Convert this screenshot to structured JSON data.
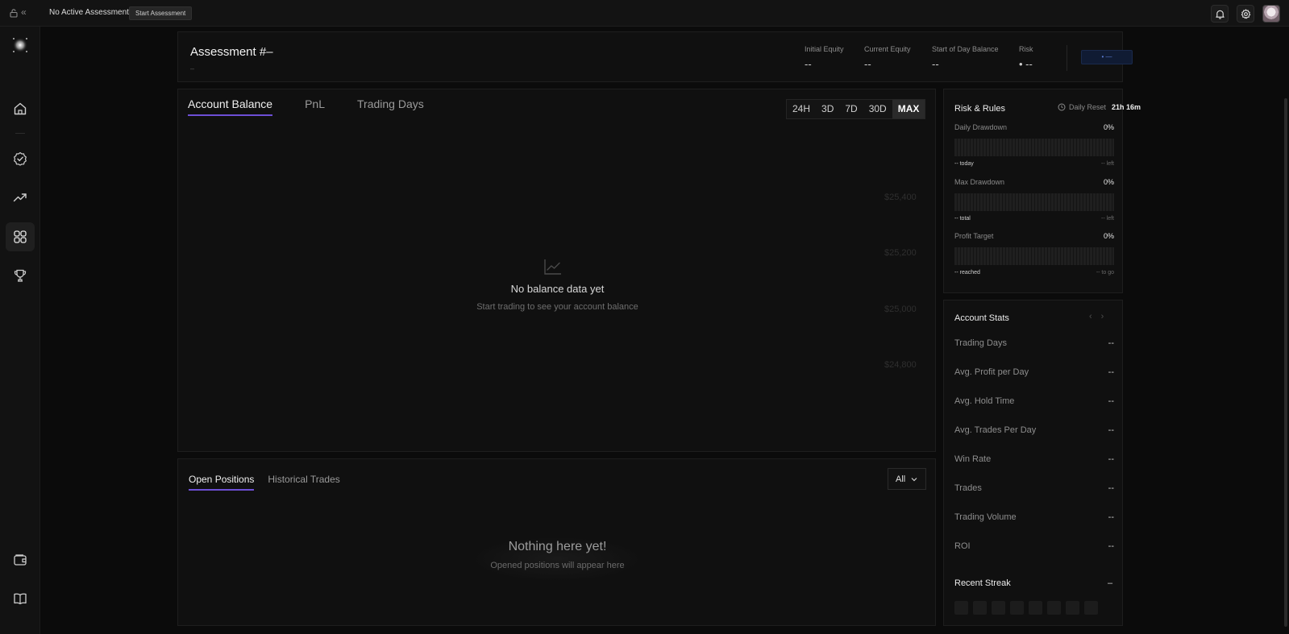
{
  "topbar": {
    "status_text": "No Active Assessment",
    "start_button": "Start Assessment",
    "collapse_glyph": "«",
    "icons": [
      "lock-icon",
      "bell-icon",
      "gear-icon"
    ]
  },
  "sidebar": {
    "items": [
      {
        "id": "home",
        "icon": "home-icon",
        "active": false
      },
      {
        "id": "assessments",
        "icon": "check-badge-icon",
        "active": false
      },
      {
        "id": "trading",
        "icon": "trend-up-icon",
        "active": false
      },
      {
        "id": "dashboard",
        "icon": "grid-icon",
        "active": true
      },
      {
        "id": "leaderboard",
        "icon": "trophy-icon",
        "active": false
      }
    ],
    "bottom_items": [
      {
        "id": "wallet",
        "icon": "wallet-icon"
      },
      {
        "id": "docs",
        "icon": "book-icon"
      }
    ]
  },
  "header": {
    "title": "Assessment #–",
    "subtitle": "–",
    "metrics": [
      {
        "label": "Initial Equity",
        "value": "--"
      },
      {
        "label": "Current Equity",
        "value": "--"
      },
      {
        "label": "Start of Day Balance",
        "value": "--"
      },
      {
        "label": "Risk",
        "value": "• --"
      }
    ],
    "pill_text": "• —"
  },
  "chart": {
    "tabs": [
      "Account Balance",
      "PnL",
      "Trading Days"
    ],
    "active_tab": "Account Balance",
    "ranges": [
      "24H",
      "3D",
      "7D",
      "30D",
      "MAX"
    ],
    "active_range": "MAX",
    "empty_title": "No balance data yet",
    "empty_subtitle": "Start trading to see your account balance",
    "y_ticks": [
      "$25,400",
      "$25,200",
      "$25,000",
      "$24,800"
    ]
  },
  "chart_data": {
    "type": "line",
    "title": "",
    "xlabel": "",
    "ylabel": "",
    "y_ticks": [
      25400,
      25200,
      25000,
      24800
    ],
    "series": [],
    "grid": false
  },
  "positions": {
    "tabs": [
      "Open Positions",
      "Historical Trades"
    ],
    "active_tab": "Open Positions",
    "filter_value": "All",
    "empty_title": "Nothing here yet!",
    "empty_subtitle": "Opened positions will appear here"
  },
  "risk": {
    "title": "Risk & Rules",
    "daily_reset_label": "Daily Reset",
    "daily_reset_value": "21h 16m",
    "rules": [
      {
        "label": "Daily Drawdown",
        "percent": "0%",
        "left_text": "-- today",
        "right_text": "-- left",
        "fill": 0
      },
      {
        "label": "Max Drawdown",
        "percent": "0%",
        "left_text": "-- total",
        "right_text": "-- left",
        "fill": 0
      },
      {
        "label": "Profit Target",
        "percent": "0%",
        "left_text": "-- reached",
        "right_text": "-- to go",
        "fill": 0
      }
    ]
  },
  "stats": {
    "title": "Account Stats",
    "prev": "‹",
    "next": "›",
    "rows": [
      {
        "label": "Trading Days",
        "value": "--"
      },
      {
        "label": "Avg. Profit per Day",
        "value": "--"
      },
      {
        "label": "Avg. Hold Time",
        "value": "--"
      },
      {
        "label": "Avg. Trades Per Day",
        "value": "--"
      },
      {
        "label": "Win Rate",
        "value": "--"
      },
      {
        "label": "Trades",
        "value": "--"
      },
      {
        "label": "Trading Volume",
        "value": "--"
      },
      {
        "label": "ROI",
        "value": "--"
      }
    ],
    "streak_title": "Recent Streak",
    "streak_value": "–",
    "streak_count": 8
  },
  "colors": {
    "accent": "#6d4fd6",
    "background": "#0b0b0b",
    "card": "#101010",
    "pill_bg": "#101b33"
  }
}
